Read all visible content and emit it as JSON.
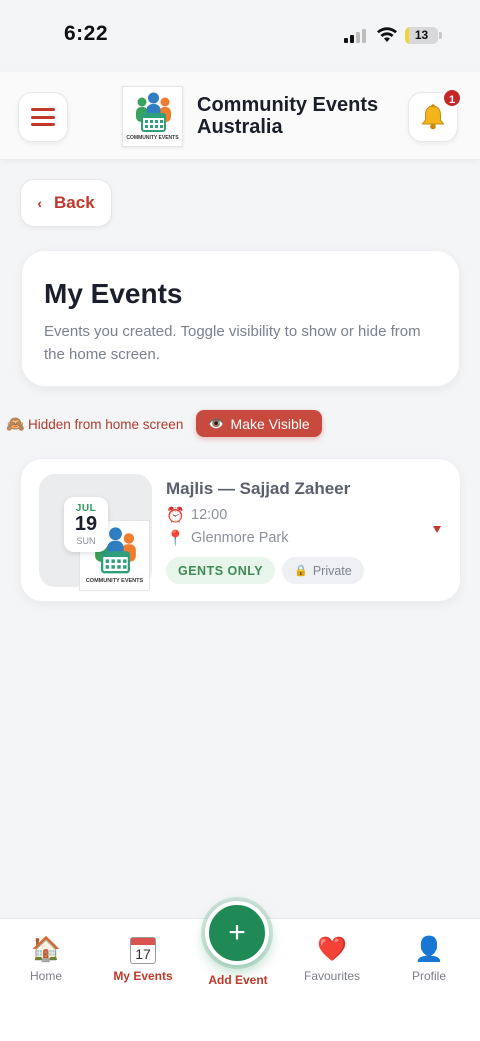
{
  "status_bar": {
    "time": "6:22",
    "battery": "13",
    "battery_level": 0.13
  },
  "header": {
    "title": "Community Events Australia",
    "logo_text": "COMMUNITY EVENTS",
    "notification_count": "1"
  },
  "back": {
    "label": "Back",
    "chevron": "‹"
  },
  "page": {
    "title": "My Events",
    "subtitle": "Events you created. Toggle visibility to show or hide from the home screen."
  },
  "visibility": {
    "status_icon": "🙈",
    "status_text": "Hidden from home screen",
    "button_icon": "👁️",
    "button_label": "Make Visible"
  },
  "event": {
    "month": "JUL",
    "day": "19",
    "weekday": "SUN",
    "title": "Majlis — Sajjad Zaheer",
    "time_icon": "⏰",
    "time": "12:00",
    "location_icon": "📍",
    "location": "Glenmore Park",
    "tag_gender": "GENTS ONLY",
    "tag_privacy_icon": "🔒",
    "tag_privacy": "Private",
    "logo_text": "COMMUNITY EVENTS"
  },
  "nav": {
    "home": {
      "icon": "🏠",
      "label": "Home"
    },
    "my_events": {
      "icon_num": "17",
      "label": "My Events"
    },
    "add_event": {
      "icon": "+",
      "label": "Add Event"
    },
    "favourites": {
      "icon": "❤️",
      "label": "Favourites"
    },
    "profile": {
      "icon": "👤",
      "label": "Profile"
    }
  },
  "colors": {
    "accent": "#c0392b",
    "green": "#1f8a55",
    "bg": "#f4f5f7"
  }
}
